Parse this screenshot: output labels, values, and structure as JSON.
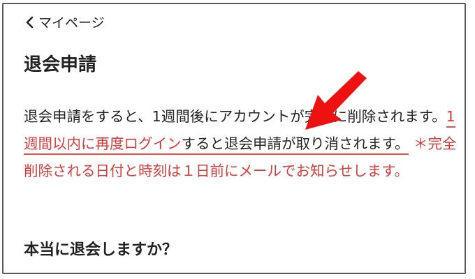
{
  "nav": {
    "back_label": "マイページ"
  },
  "page": {
    "title": "退会申請"
  },
  "message": {
    "part1": "退会申請をすると、1週間後にアカウントが完全に削除されます。",
    "highlight": "1週間以内に再度ログイン",
    "part2": "すると退会申請が",
    "underlined_end": "取り消されます。",
    "note": "＊完全削除される日付と時刻は１日前にメールでお知らせします。"
  },
  "question": {
    "text": "本当に退会しますか？"
  },
  "icons": {
    "back": "chevron-left-icon",
    "annotation": "red-arrow-annotation"
  },
  "colors": {
    "accent_red": "#d93a3a",
    "arrow_red": "#ee1111",
    "text": "#222222",
    "border": "#5a5a5a"
  }
}
